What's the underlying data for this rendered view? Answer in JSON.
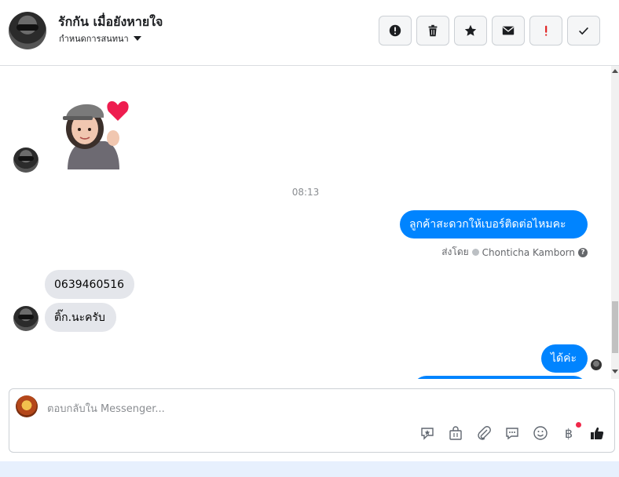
{
  "header": {
    "title": "รักกัน เมื่อยังหายใจ",
    "subtitle": "กำหนดการสนทนา",
    "toolbar": [
      {
        "icon": "alert-circle-icon"
      },
      {
        "icon": "trash-icon"
      },
      {
        "icon": "star-icon"
      },
      {
        "icon": "envelope-icon"
      },
      {
        "icon": "exclamation-icon"
      },
      {
        "icon": "check-icon"
      }
    ]
  },
  "thread": {
    "timestamp": "08:13",
    "messages": {
      "out_1": "ลูกค้าสะดวกให้เบอร์ติดต่อไหมคะ",
      "sent_by_label": "ส่งโดย",
      "sent_by_name": "Chonticha Kamborn",
      "in_1": "0639460516",
      "in_2": "ติ๊ก.นะครับ",
      "out_2": "ได้ค่ะ"
    }
  },
  "composer": {
    "placeholder": "ตอบกลับใน Messenger...",
    "baht_symbol": "฿",
    "tools": [
      "sticker-icon",
      "bag-icon",
      "paperclip-icon",
      "chat-bubble-icon",
      "emoji-icon",
      "baht-icon",
      "thumbs-up-icon"
    ]
  },
  "colors": {
    "accent": "#0084ff",
    "incoming_bubble": "#e4e6eb",
    "alert_red": "#e02020"
  }
}
